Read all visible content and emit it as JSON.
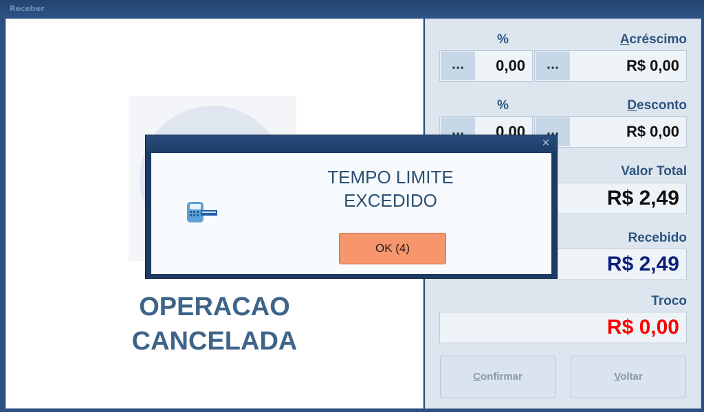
{
  "window": {
    "title": "Receber"
  },
  "left": {
    "illustration_icon": "payment-terminal-illustration",
    "status_line1": "OPERACAO",
    "status_line2": "CANCELADA"
  },
  "right": {
    "acrescimo": {
      "percent_label": "%",
      "label_first": "A",
      "label_rest": "créscimo",
      "dots": "...",
      "percent_value": "0,00",
      "value": "R$ 0,00"
    },
    "desconto": {
      "percent_label": "%",
      "label_first": "D",
      "label_rest": "esconto",
      "dots": "...",
      "percent_value": "0,00",
      "value": "R$ 0,00"
    },
    "valor_total": {
      "label": "Valor Total",
      "value": "R$ 2,49"
    },
    "recebido": {
      "label": "Recebido",
      "value": "R$ 2,49"
    },
    "troco": {
      "label": "Troco",
      "value": "R$ 0,00"
    },
    "confirmar": {
      "first": "C",
      "rest": "onfirmar"
    },
    "voltar": {
      "first": "V",
      "rest": "oltar"
    }
  },
  "dialog": {
    "close": "×",
    "message_line1": "TEMPO LIMITE",
    "message_line2": "EXCEDIDO",
    "ok_label": "OK (4)",
    "icon": "card-terminal-icon"
  },
  "colors": {
    "value_blue": "#0b1f7a",
    "value_red": "#ff0000",
    "ok_button": "#f7956c"
  }
}
